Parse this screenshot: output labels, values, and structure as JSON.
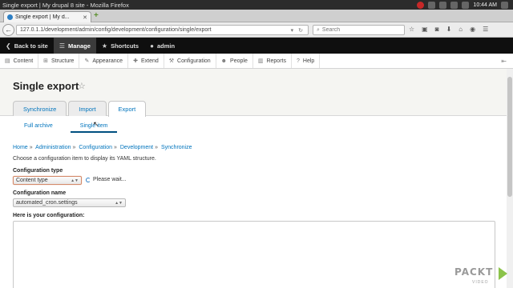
{
  "os": {
    "window_title": "Single export | My drupal 8 site - Mozilla Firefox",
    "time": "10:44 AM"
  },
  "browser": {
    "tab_title": "Single export | My d...",
    "url": "127.0.1.1/development/admin/config/development/configuration/single/export",
    "search_placeholder": "Search"
  },
  "admin_toolbar": {
    "back_to_site": "Back to site",
    "manage": "Manage",
    "shortcuts": "Shortcuts",
    "user": "admin"
  },
  "menu": [
    {
      "label": "Content",
      "icon": "file-icon"
    },
    {
      "label": "Structure",
      "icon": "structure-icon"
    },
    {
      "label": "Appearance",
      "icon": "brush-icon"
    },
    {
      "label": "Extend",
      "icon": "puzzle-icon"
    },
    {
      "label": "Configuration",
      "icon": "wrench-icon"
    },
    {
      "label": "People",
      "icon": "people-icon"
    },
    {
      "label": "Reports",
      "icon": "chart-icon"
    },
    {
      "label": "Help",
      "icon": "help-icon"
    }
  ],
  "page": {
    "title": "Single export",
    "primary_tabs": [
      "Synchronize",
      "Import",
      "Export"
    ],
    "active_primary_tab": "Export",
    "secondary_tabs": [
      "Full archive",
      "Single item"
    ],
    "active_secondary_tab": "Single item"
  },
  "breadcrumb": [
    "Home",
    "Administration",
    "Configuration",
    "Development",
    "Synchronize"
  ],
  "form": {
    "intro": "Choose a configuration item to display its YAML structure.",
    "config_type_label": "Configuration type",
    "config_type_value": "Content type",
    "loading_text": "Please wait...",
    "config_name_label": "Configuration name",
    "config_name_value": "automated_cron.settings",
    "output_label": "Here is your configuration:"
  },
  "branding": {
    "logo": "PACKT",
    "logo_sub": "VIDEO"
  },
  "colors": {
    "link": "#0074bd",
    "toolbar_bg": "#0f0f0f",
    "header_bg": "#f5f5f2"
  }
}
